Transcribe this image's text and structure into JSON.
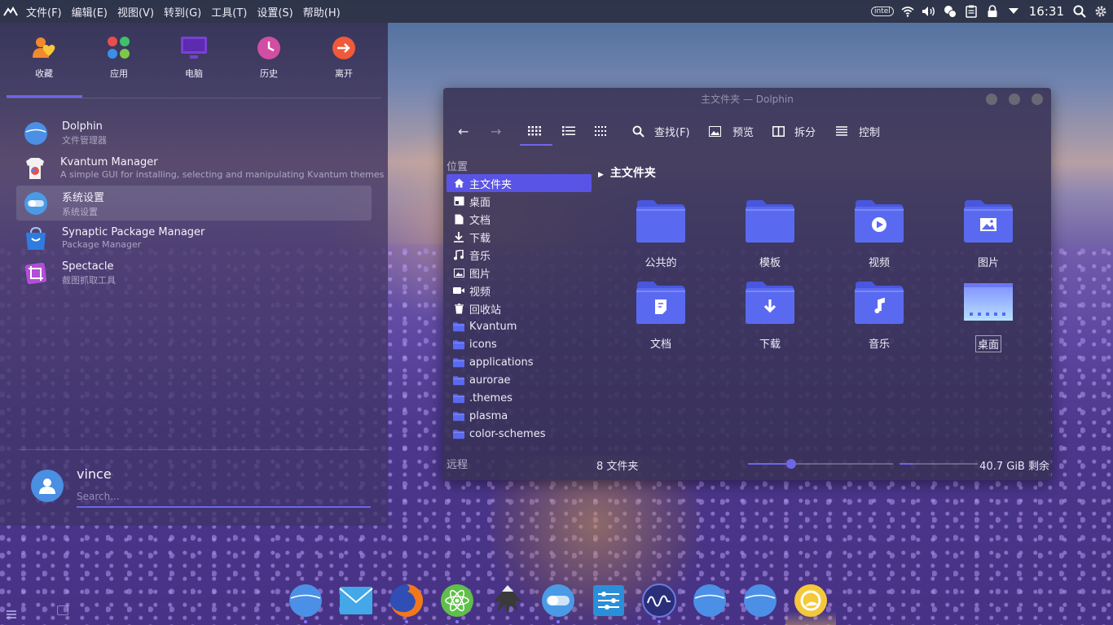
{
  "colors": {
    "accent": "#6e66e8",
    "folder": "#5a6af0",
    "panel": "#282838"
  },
  "top_panel": {
    "menu": [
      "文件(F)",
      "编辑(E)",
      "视图(V)",
      "转到(G)",
      "工具(T)",
      "设置(S)",
      "帮助(H)"
    ],
    "clock": "16:31",
    "tray_icons": [
      "intel-icon",
      "wifi-icon",
      "volume-icon",
      "chat-icon",
      "clipboard-icon",
      "lock-icon",
      "expand-icon"
    ],
    "intel_label": "intel"
  },
  "launcher": {
    "categories": [
      {
        "label": "收藏",
        "icon": "favorites-icon"
      },
      {
        "label": "应用",
        "icon": "applications-icon"
      },
      {
        "label": "电脑",
        "icon": "computer-icon"
      },
      {
        "label": "历史",
        "icon": "history-icon"
      },
      {
        "label": "离开",
        "icon": "leave-icon"
      }
    ],
    "apps": [
      {
        "name": "Dolphin",
        "desc": "文件管理器",
        "icon": "dolphin-icon"
      },
      {
        "name": "Kvantum Manager",
        "desc": "A simple GUI for installing, selecting and manipulating Kvantum themes",
        "icon": "kvantum-icon"
      },
      {
        "name": "系统设置",
        "desc": "系统设置",
        "icon": "settings-toggle-icon"
      },
      {
        "name": "Synaptic Package Manager",
        "desc": "Package Manager",
        "icon": "synaptic-icon"
      },
      {
        "name": "Spectacle",
        "desc": "截图抓取工具",
        "icon": "spectacle-icon"
      }
    ],
    "user": "vince",
    "search_placeholder": "Search..."
  },
  "dolphin": {
    "title": "主文件夹 — Dolphin",
    "toolbar": {
      "find": "查找(F)",
      "preview": "预览",
      "split": "拆分",
      "control": "控制"
    },
    "places_header": "位置",
    "places": [
      {
        "label": "主文件夹",
        "icon": "home-icon"
      },
      {
        "label": "桌面",
        "icon": "desktop-icon"
      },
      {
        "label": "文档",
        "icon": "document-icon"
      },
      {
        "label": "下载",
        "icon": "download-icon"
      },
      {
        "label": "音乐",
        "icon": "music-icon"
      },
      {
        "label": "图片",
        "icon": "picture-icon"
      },
      {
        "label": "视频",
        "icon": "video-icon"
      },
      {
        "label": "回收站",
        "icon": "trash-icon"
      },
      {
        "label": "Kvantum",
        "icon": "folder-icon"
      },
      {
        "label": "icons",
        "icon": "folder-icon"
      },
      {
        "label": "applications",
        "icon": "folder-icon"
      },
      {
        "label": "aurorae",
        "icon": "folder-icon"
      },
      {
        "label": ".themes",
        "icon": "folder-icon"
      },
      {
        "label": "plasma",
        "icon": "folder-icon"
      },
      {
        "label": "color-schemes",
        "icon": "folder-icon"
      }
    ],
    "remote_header": "远程",
    "breadcrumb": "主文件夹",
    "files": [
      {
        "label": "公共的",
        "icon": "folder-icon"
      },
      {
        "label": "模板",
        "icon": "folder-icon"
      },
      {
        "label": "视频",
        "icon": "folder-video-icon"
      },
      {
        "label": "图片",
        "icon": "folder-pictures-icon"
      },
      {
        "label": "文档",
        "icon": "folder-documents-icon"
      },
      {
        "label": "下载",
        "icon": "folder-download-icon"
      },
      {
        "label": "音乐",
        "icon": "folder-music-icon"
      },
      {
        "label": "桌面",
        "icon": "folder-desktop-icon"
      }
    ],
    "status": {
      "count": "8 文件夹",
      "free": "40.7 GiB 剩余",
      "zoom_fraction": 0.3,
      "space_used_fraction": 0.17
    }
  },
  "dock": {
    "items": [
      {
        "icon": "dolphin-icon",
        "running": true
      },
      {
        "icon": "mail-icon",
        "running": false
      },
      {
        "icon": "firefox-icon",
        "running": true
      },
      {
        "icon": "atom-icon",
        "running": true
      },
      {
        "icon": "inkscape-icon",
        "running": false
      },
      {
        "icon": "settings-toggle-icon",
        "running": true
      },
      {
        "icon": "control-panel-icon",
        "running": false
      },
      {
        "icon": "monitor-icon",
        "running": true
      },
      {
        "icon": "dolphin-icon",
        "running": false
      },
      {
        "icon": "dolphin-icon",
        "running": false
      },
      {
        "icon": "weather-icon",
        "running": false
      }
    ]
  }
}
